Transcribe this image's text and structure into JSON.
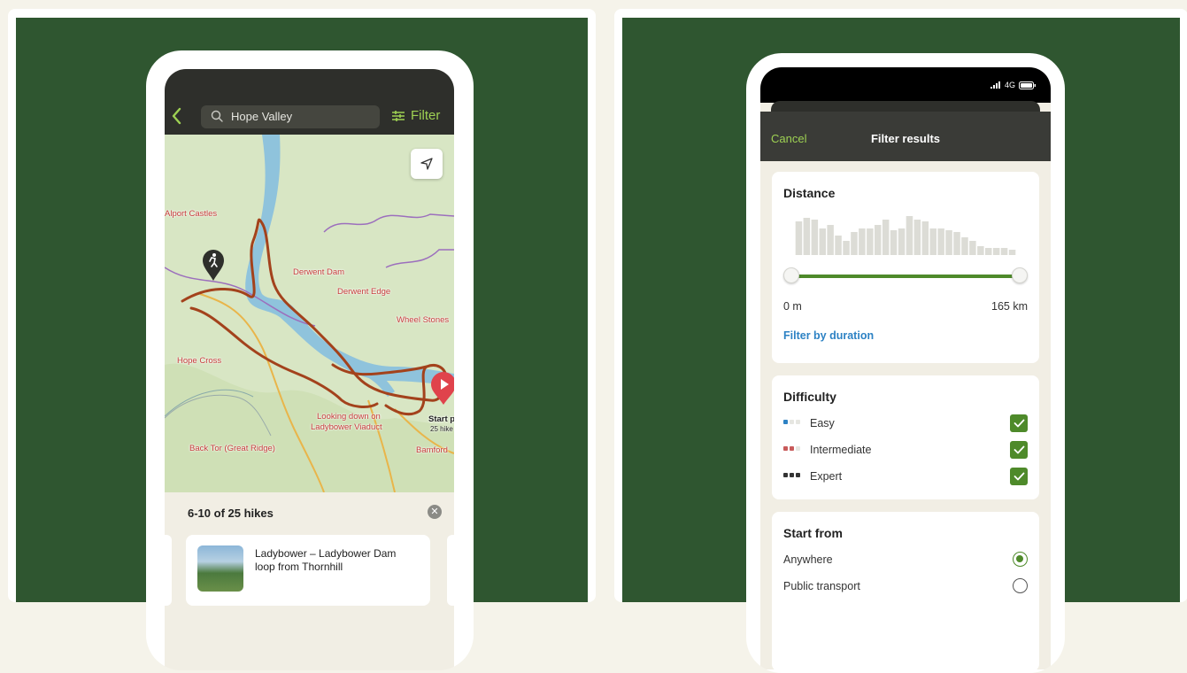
{
  "left": {
    "search": {
      "value": "Hope Valley"
    },
    "filter_label": "Filter",
    "map_labels": {
      "alport": "Alport Castles",
      "derwent_dam": "Derwent Dam",
      "derwent_edge": "Derwent Edge",
      "wheel_stones": "Wheel Stones",
      "hope_cross": "Hope Cross",
      "looking_down_1": "Looking down on",
      "looking_down_2": "Ladybower Viaduct",
      "start_1": "Start po",
      "start_2": "25 hike",
      "back_tor": "Back Tor (Great Ridge)",
      "bamford": "Bamford"
    },
    "results": {
      "count": "6-10 of 25 hikes",
      "card_title": "Ladybower – Ladybower Dam loop from Thornhill"
    }
  },
  "right": {
    "status": {
      "network": "4G"
    },
    "header": {
      "cancel": "Cancel",
      "title": "Filter results"
    },
    "distance": {
      "title": "Distance",
      "min_label": "0 m",
      "max_label": "165 km",
      "duration_link": "Filter by duration",
      "range_fraction": [
        0,
        1
      ],
      "histogram": [
        38,
        42,
        40,
        30,
        34,
        22,
        16,
        26,
        30,
        30,
        34,
        40,
        28,
        30,
        44,
        40,
        38,
        30,
        30,
        28,
        26,
        20,
        16,
        10,
        8,
        8,
        8,
        6
      ]
    },
    "difficulty": {
      "title": "Difficulty",
      "items": [
        {
          "label": "Easy",
          "checked": true,
          "color": "#2d82c4",
          "dots": 1
        },
        {
          "label": "Intermediate",
          "checked": true,
          "color": "#c85a5a",
          "dots": 2
        },
        {
          "label": "Expert",
          "checked": true,
          "color": "#333333",
          "dots": 3
        }
      ]
    },
    "start_from": {
      "title": "Start from",
      "items": [
        {
          "label": "Anywhere",
          "selected": true
        },
        {
          "label": "Public transport",
          "selected": false
        }
      ]
    }
  },
  "colors": {
    "accent_green": "#9ed153",
    "check_green": "#4e8a2a",
    "bg_green": "#2f5630",
    "route": "#a3421c"
  }
}
